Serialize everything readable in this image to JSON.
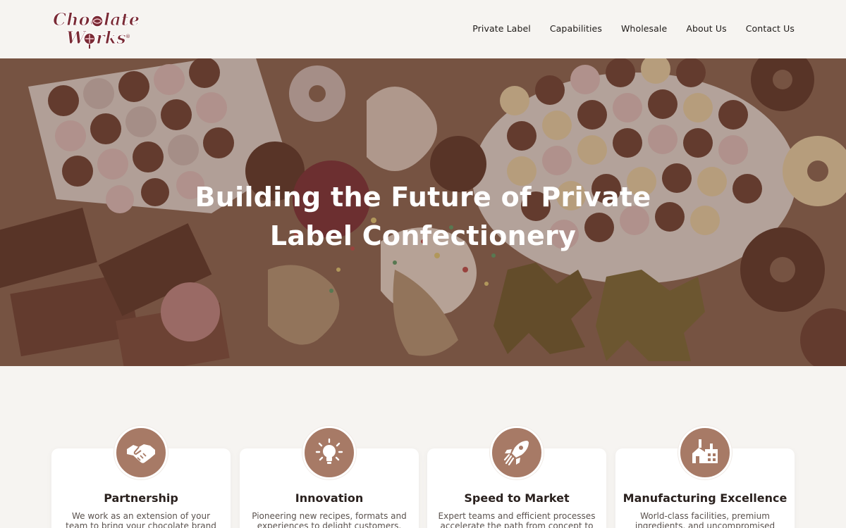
{
  "header": {
    "logo_text": "Chocolate Works",
    "nav": [
      {
        "label": "Private Label"
      },
      {
        "label": "Capabilities"
      },
      {
        "label": "Wholesale"
      },
      {
        "label": "About Us"
      },
      {
        "label": "Contact Us"
      }
    ]
  },
  "hero": {
    "title_line1": "Building the Future of Private",
    "title_line2": "Label Confectionery"
  },
  "features": [
    {
      "icon": "handshake-icon",
      "title": "Partnership",
      "text": "We work as an extension of your team to bring your chocolate brand to life."
    },
    {
      "icon": "lightbulb-icon",
      "title": "Innovation",
      "text": "Pioneering new recipes, formats and experiences to delight customers."
    },
    {
      "icon": "rocket-icon",
      "title": "Speed to Market",
      "text": "Expert teams and efficient processes accelerate the path from concept to shelf."
    },
    {
      "icon": "factory-icon",
      "title": "Manufacturing Excellence",
      "text": "World-class facilities, premium ingredients, and uncompromised quality."
    }
  ],
  "colors": {
    "accent": "#a77a66",
    "background": "#f6f4f1",
    "brand": "#7a2a35"
  }
}
